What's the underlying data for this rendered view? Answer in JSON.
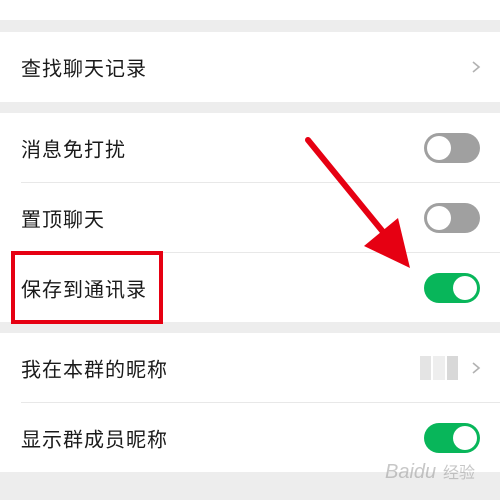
{
  "settings": {
    "search_history": {
      "label": "查找聊天记录"
    },
    "mute": {
      "label": "消息免打扰",
      "enabled": false
    },
    "pin_top": {
      "label": "置顶聊天",
      "enabled": false
    },
    "save_contacts": {
      "label": "保存到通讯录",
      "enabled": true
    },
    "group_nickname": {
      "label": "我在本群的昵称"
    },
    "show_member_names": {
      "label": "显示群成员昵称",
      "enabled": true
    }
  },
  "colors": {
    "toggle_on": "#08b65a",
    "toggle_off": "#a0a0a0",
    "annotation_red": "#e60012",
    "background": "#ededed"
  },
  "watermark": {
    "text": "Baidu 经验"
  }
}
